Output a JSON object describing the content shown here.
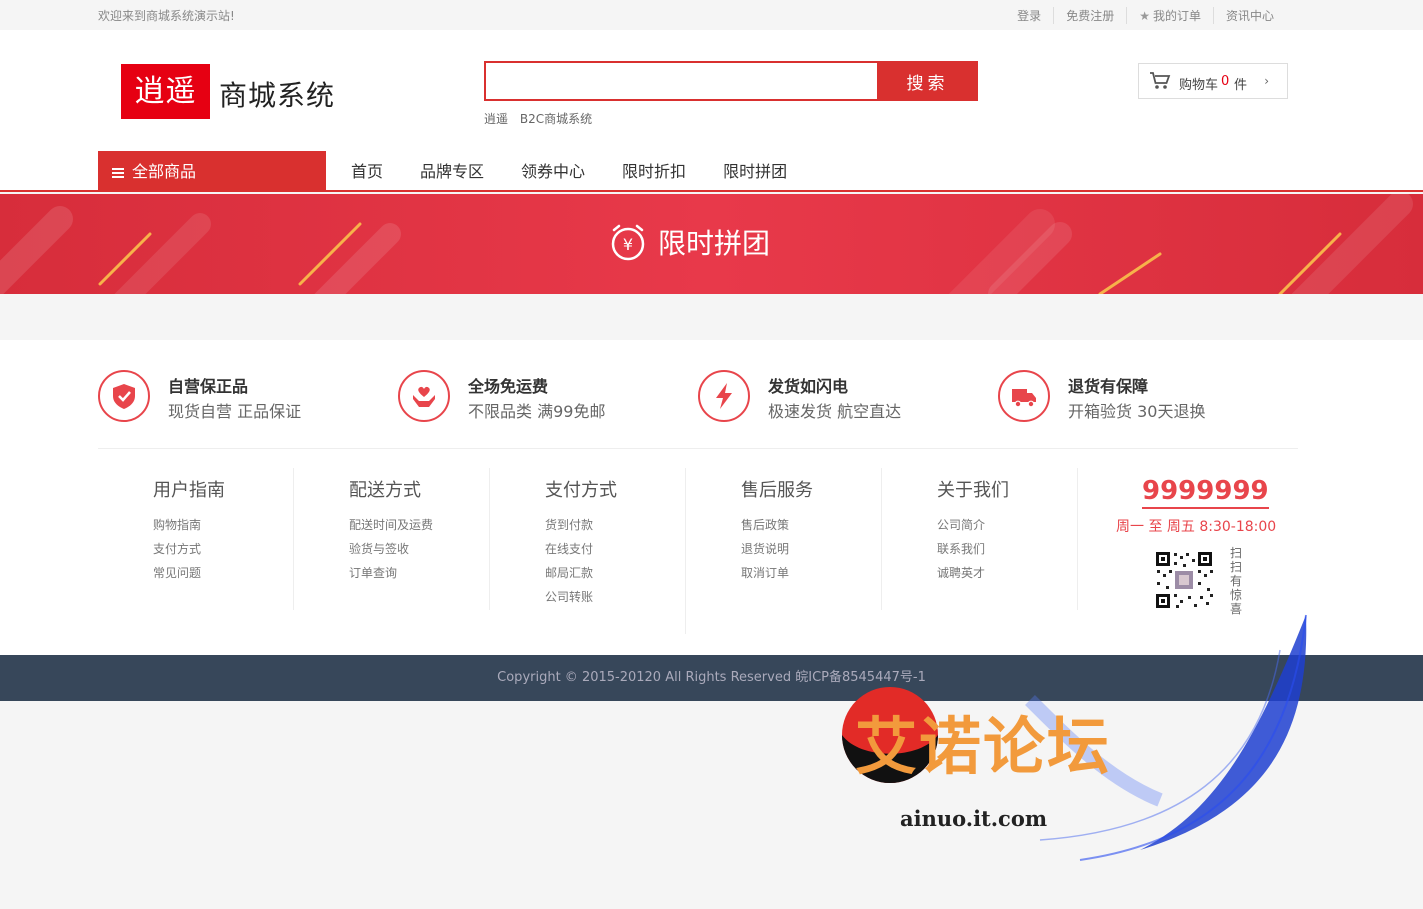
{
  "topbar": {
    "welcome": "欢迎来到商城系统演示站!",
    "links": [
      "登录",
      "免费注册",
      "我的订单",
      "资讯中心"
    ]
  },
  "header": {
    "logo_mark": "逍遥",
    "logo_text": "商城系统",
    "search": {
      "placeholder": "",
      "button": "搜索"
    },
    "hot_words": [
      "逍遥",
      "B2C商城系统"
    ],
    "cart": {
      "label": "购物车",
      "count": "0",
      "unit": "件"
    }
  },
  "nav": {
    "all_categories": "全部商品",
    "items": [
      "首页",
      "品牌专区",
      "领券中心",
      "限时折扣",
      "限时拼团"
    ]
  },
  "banner": {
    "title": "限时拼团"
  },
  "services": [
    {
      "title": "自营保正品",
      "desc": "现货自营 正品保证",
      "icon": "shield-check-icon"
    },
    {
      "title": "全场免运费",
      "desc": "不限品类 满99免邮",
      "icon": "hands-heart-icon"
    },
    {
      "title": "发货如闪电",
      "desc": "极速发货 航空直达",
      "icon": "lightning-icon"
    },
    {
      "title": "退货有保障",
      "desc": "开箱验货 30天退换",
      "icon": "truck-icon"
    }
  ],
  "footer_cols": [
    {
      "title": "用户指南",
      "links": [
        "购物指南",
        "支付方式",
        "常见问题"
      ]
    },
    {
      "title": "配送方式",
      "links": [
        "配送时间及运费",
        "验货与签收",
        "订单查询"
      ]
    },
    {
      "title": "支付方式",
      "links": [
        "货到付款",
        "在线支付",
        "邮局汇款",
        "公司转账"
      ]
    },
    {
      "title": "售后服务",
      "links": [
        "售后政策",
        "退货说明",
        "取消订单"
      ]
    },
    {
      "title": "关于我们",
      "links": [
        "公司简介",
        "联系我们",
        "诚聘英才"
      ]
    }
  ],
  "contact": {
    "phone": "9999999",
    "hours": "周一 至 周五   8:30-18:00",
    "qr_caption": "扫扫有惊喜"
  },
  "copyright": "Copyright © 2015-20120 All Rights Reserved 皖ICP备8545447号-1",
  "watermark": {
    "text": "艾诺论坛",
    "url": "ainuo.it.com"
  },
  "colors": {
    "accent": "#d9302f",
    "footer_bar": "#37475a"
  }
}
